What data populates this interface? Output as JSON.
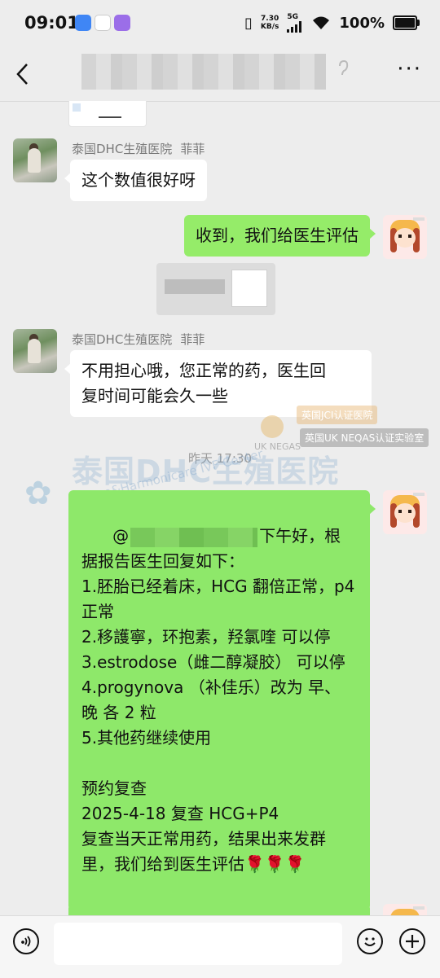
{
  "status": {
    "time": "09:01",
    "net_speed_value": "7.30",
    "net_speed_unit": "KB/s",
    "network": "5G",
    "battery": "100%",
    "battery_level": 1.0
  },
  "nav": {
    "back_icon": "back-chevron-icon",
    "more_icon": "more-dots-icon",
    "more_label": "···"
  },
  "messages": [
    {
      "side": "left",
      "sender_org": "泰国DHC生殖医院",
      "sender_nick": "菲菲",
      "text": "这个数值很好呀"
    },
    {
      "side": "right",
      "text": "收到，我们给医生评估"
    },
    {
      "side": "left",
      "sender_org": "泰国DHC生殖医院",
      "sender_nick": "菲菲",
      "text": "不用担心哦，您正常的药，医生回\n复时间可能会久一些"
    }
  ],
  "timestamp": "昨天 17:30",
  "watermark": {
    "main": "泰国DHC生殖医院",
    "sub": "Deep&Harmonicare IVF Center",
    "badge1": "英国JCI认证医院",
    "badge2": "英国UK NEQAS认证实验室",
    "uk_neqas": "UK NEGAS"
  },
  "long_message": {
    "mention_prefix": "@",
    "greeting_tail": "下午好，根据报告医生回复如下：",
    "body": "\n1.胚胎已经着床，HCG 翻倍正常，p4 正常\n2.移護寧，环抱素，羟氯喹 可以停\n3.estrodose（雌二醇凝胶） 可以停\n4.progynova （补佳乐）改为 早、晚 各 2 粒\n5.其他药继续使用\n\n预约复查\n2025-4-18 复查 HCG+P4\n复查当天正常用药，结果出来发群里，我们给到医生评估🌹🌹🌹"
  },
  "input_bar": {
    "voice_icon": "voice-icon",
    "emoji_icon": "emoji-icon",
    "plus_icon": "plus-icon"
  }
}
